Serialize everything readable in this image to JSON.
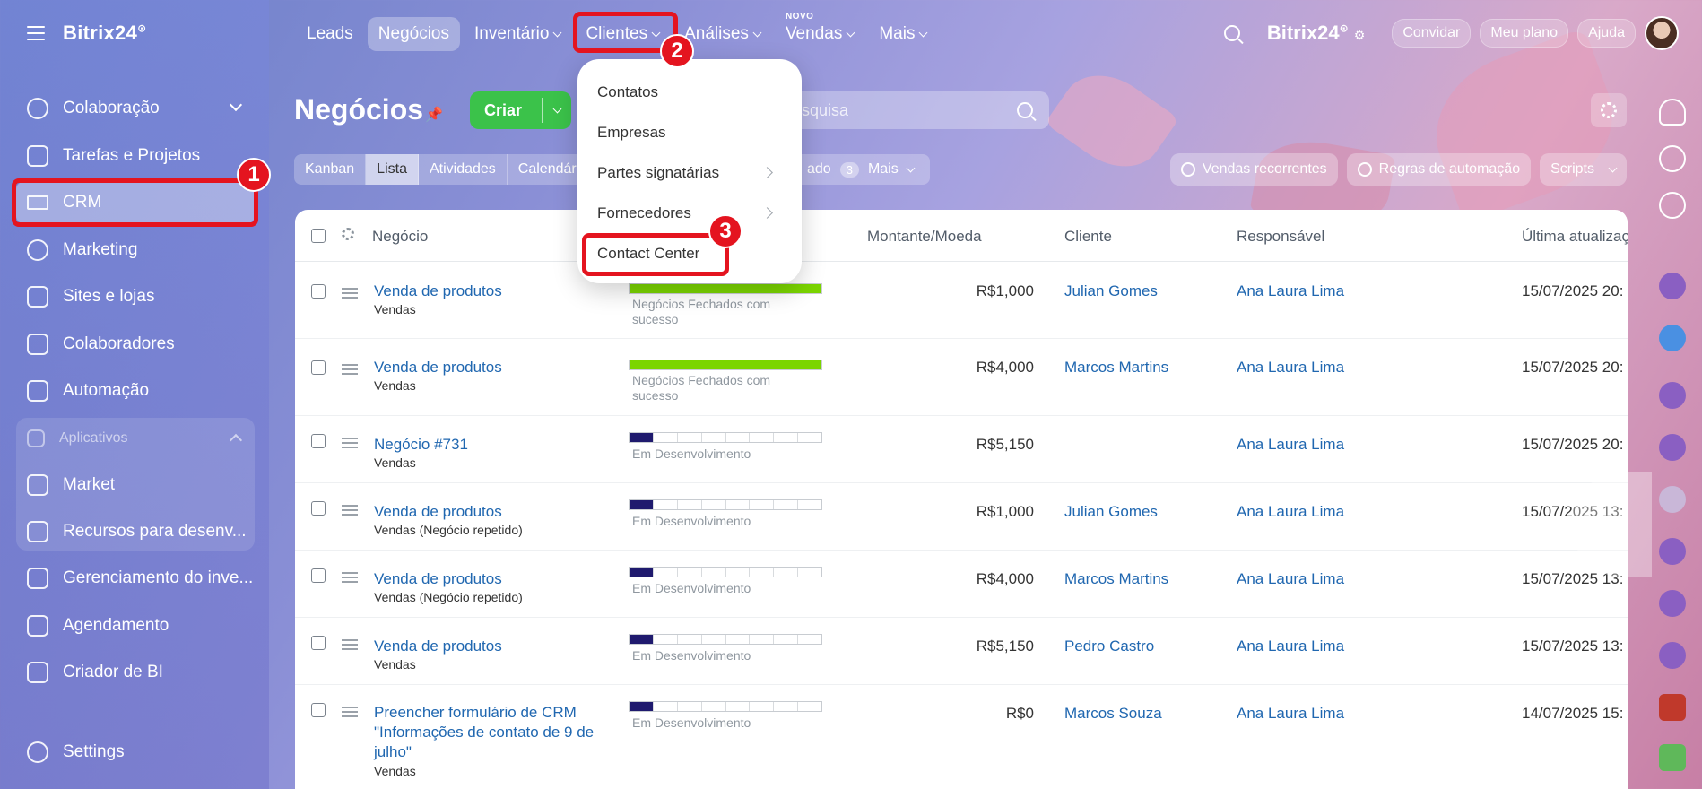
{
  "app": {
    "brand": "Bitrix24"
  },
  "sidebar": {
    "items": [
      {
        "label": "Colaboração"
      },
      {
        "label": "Tarefas e Projetos"
      },
      {
        "label": "CRM"
      },
      {
        "label": "Marketing"
      },
      {
        "label": "Sites e lojas"
      },
      {
        "label": "Colaboradores"
      },
      {
        "label": "Automação"
      },
      {
        "label": "Aplicativos"
      },
      {
        "label": "Market"
      },
      {
        "label": "Recursos para desenv..."
      },
      {
        "label": "Gerenciamento do inve..."
      },
      {
        "label": "Agendamento"
      },
      {
        "label": "Criador de BI"
      },
      {
        "label": "Settings"
      }
    ]
  },
  "topnav": {
    "items": [
      "Leads",
      "Negócios",
      "Inventário",
      "Clientes",
      "Análises",
      "Vendas",
      "Mais"
    ],
    "novo_badge": "NOVO",
    "right": {
      "convidar": "Convidar",
      "meu_plano": "Meu plano",
      "ajuda": "Ajuda"
    }
  },
  "page": {
    "title": "Negócios",
    "criar": "Criar",
    "search_placeholder": "esquisa",
    "view_tabs": [
      "Kanban",
      "Lista",
      "Atividades",
      "Calendári"
    ],
    "filter_tail": {
      "label": "ado",
      "count": "3",
      "mais": "Mais"
    },
    "buttons": {
      "vendas_recorrentes": "Vendas recorrentes",
      "regras": "Regras de automação",
      "scripts": "Scripts"
    }
  },
  "table": {
    "headers": {
      "negocio": "Negócio",
      "montante": "Montante/Moeda",
      "cliente": "Cliente",
      "responsavel": "Responsável",
      "atualizacao": "Última atualizaç"
    },
    "rows": [
      {
        "title": "Venda de produtos",
        "sub": "Vendas",
        "stage": "Negócios Fechados com sucesso",
        "amount": "R$1,000",
        "client": "Julian Gomes",
        "resp": "Ana Laura Lima",
        "date": "15/07/2025 20:"
      },
      {
        "title": "Venda de produtos",
        "sub": "Vendas",
        "stage": "Negócios Fechados com sucesso",
        "amount": "R$4,000",
        "client": "Marcos Martins",
        "resp": "Ana Laura Lima",
        "date": "15/07/2025 20:"
      },
      {
        "title": "Negócio #731",
        "sub": "Vendas",
        "stage": "Em Desenvolvimento",
        "amount": "R$5,150",
        "client": "",
        "resp": "Ana Laura Lima",
        "date": "15/07/2025 20:"
      },
      {
        "title": "Venda de produtos",
        "sub": "Vendas (Negócio repetido)",
        "stage": "Em Desenvolvimento",
        "amount": "R$1,000",
        "client": "Julian Gomes",
        "resp": "Ana Laura Lima",
        "date": "15/07/2025 13:"
      },
      {
        "title": "Venda de produtos",
        "sub": "Vendas (Negócio repetido)",
        "stage": "Em Desenvolvimento",
        "amount": "R$4,000",
        "client": "Marcos Martins",
        "resp": "Ana Laura Lima",
        "date": "15/07/2025 13:"
      },
      {
        "title": "Venda de produtos",
        "sub": "Vendas",
        "stage": "Em Desenvolvimento",
        "amount": "R$5,150",
        "client": "Pedro Castro",
        "resp": "Ana Laura Lima",
        "date": "15/07/2025 13:"
      },
      {
        "title": "Preencher formulário de CRM \"Informações de contato de 9 de julho\"",
        "sub": "Vendas",
        "stage": "Em Desenvolvimento",
        "amount": "R$0",
        "client": "Marcos Souza",
        "resp": "Ana Laura Lima",
        "date": "14/07/2025 15:"
      }
    ]
  },
  "dropdown": {
    "items": [
      "Contatos",
      "Empresas",
      "Partes signatárias",
      "Fornecedores",
      "Contact Center"
    ]
  },
  "annotations": {
    "one": "1",
    "two": "2",
    "three": "3"
  },
  "colors": {
    "accent_green": "#3bc24a",
    "highlight_red": "#e4141f",
    "link_blue": "#2067b0",
    "stage_dark": "#1f1a6e",
    "stage_green": "#7bd500"
  }
}
